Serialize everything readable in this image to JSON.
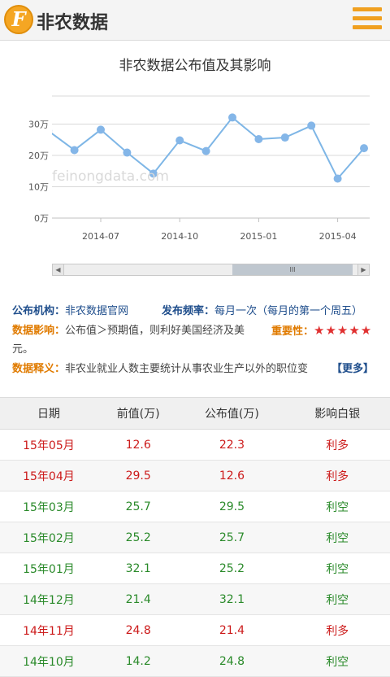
{
  "header": {
    "logo_letter": "F",
    "logo_text": "非农数据"
  },
  "chart_title": "非农数据公布值及其影响",
  "watermark": "feinongdata.com",
  "colors": {
    "line": "#7eb6e6",
    "point": "#84b6e8",
    "grid": "#d9d9d9",
    "accent": "#f5a623",
    "bullish": "#cc1a1a",
    "bearish": "#2a8a2a"
  },
  "chart_data": {
    "type": "line",
    "title": "非农数据公布值及其影响",
    "y_ticks": [
      "0万",
      "10万",
      "20万",
      "30万"
    ],
    "ylim": [
      0,
      40
    ],
    "x_ticks": [
      "2014-07",
      "2014-10",
      "2015-01",
      "2015-04"
    ],
    "grid": true,
    "series": [
      {
        "x": [
          "2014-05",
          "2014-06",
          "2014-07",
          "2014-08",
          "2014-09",
          "2014-10",
          "2014-11",
          "2014-12",
          "2015-01",
          "2015-02",
          "2015-03",
          "2015-04",
          "2015-05"
        ],
        "values": [
          27.9,
          21.7,
          28.2,
          20.9,
          14.2,
          24.8,
          21.4,
          32.1,
          25.2,
          25.7,
          29.5,
          12.6,
          22.3
        ]
      }
    ]
  },
  "scrollbar": {
    "left_arrow": "◀",
    "right_arrow": "▶",
    "grip": "III"
  },
  "info": {
    "publisher_label": "公布机构：",
    "publisher_value": "非农数据官网",
    "frequency_label": "发布频率：",
    "frequency_value": "每月一次（每月的第一个周五）",
    "impact_label": "数据影响：",
    "impact_value_line1": "公布值＞预期值，则利好美国经济及美",
    "impact_value_line2": "元。",
    "importance_label": "重要性：",
    "importance_stars": "★★★★★",
    "definition_label": "数据释义：",
    "definition_value": "非农业就业人数主要统计从事农业生产以外的职位变",
    "more_link": "【更多】"
  },
  "table": {
    "headers": [
      "日期",
      "前值(万)",
      "公布值(万)",
      "影响白银"
    ],
    "rows": [
      {
        "date": "15年05月",
        "prev": "12.6",
        "pub": "22.3",
        "effect": "利多",
        "tone": "red"
      },
      {
        "date": "15年04月",
        "prev": "29.5",
        "pub": "12.6",
        "effect": "利多",
        "tone": "red"
      },
      {
        "date": "15年03月",
        "prev": "25.7",
        "pub": "29.5",
        "effect": "利空",
        "tone": "green"
      },
      {
        "date": "15年02月",
        "prev": "25.2",
        "pub": "25.7",
        "effect": "利空",
        "tone": "green"
      },
      {
        "date": "15年01月",
        "prev": "32.1",
        "pub": "25.2",
        "effect": "利空",
        "tone": "green"
      },
      {
        "date": "14年12月",
        "prev": "21.4",
        "pub": "32.1",
        "effect": "利空",
        "tone": "green"
      },
      {
        "date": "14年11月",
        "prev": "24.8",
        "pub": "21.4",
        "effect": "利多",
        "tone": "red"
      },
      {
        "date": "14年10月",
        "prev": "14.2",
        "pub": "24.8",
        "effect": "利空",
        "tone": "green"
      }
    ]
  }
}
